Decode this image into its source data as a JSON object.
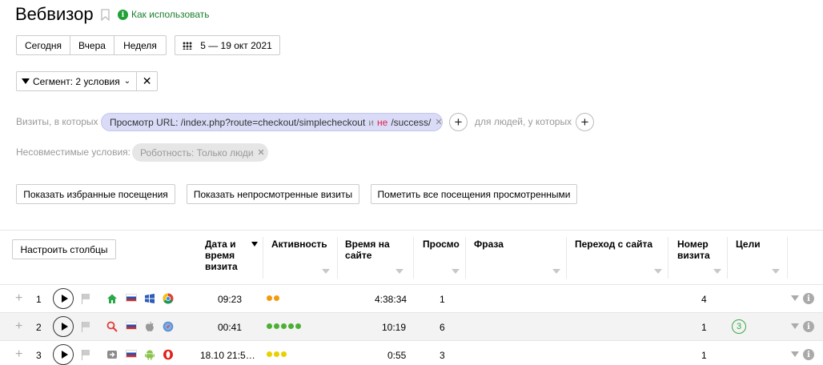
{
  "header": {
    "title": "Вебвизор",
    "how_to_use": "Как использовать"
  },
  "period": {
    "today": "Сегодня",
    "yesterday": "Вчера",
    "week": "Неделя",
    "date_range": "5 — 19 окт 2021"
  },
  "segment": {
    "label": "Сегмент: 2 условия"
  },
  "conditions": {
    "visits_label": "Визиты, в которых",
    "chip_text": "Просмотр URL: /index.php?route=checkout/simplecheckout",
    "chip_and": "и",
    "chip_not": "не",
    "chip_tail": "/success/",
    "people_label": "для людей, у которых",
    "incompatible_label": "Несовместимые условия:",
    "incompatible_chip": "Роботность: Только люди"
  },
  "actions": {
    "show_favorites": "Показать избранные посещения",
    "show_unviewed": "Показать непросмотренные визиты",
    "mark_all_viewed": "Пометить все посещения просмотренными"
  },
  "table": {
    "configure_columns": "Настроить столбцы",
    "headers": {
      "date": [
        "Дата и",
        "время",
        "визита"
      ],
      "activity": "Активность",
      "time": [
        "Время на",
        "сайте"
      ],
      "views": "Просмо",
      "phrase": "Фраза",
      "referrer": "Переход с сайта",
      "visit_number": [
        "Номер",
        "визита"
      ],
      "goals": "Цели"
    },
    "rows": [
      {
        "num": "1",
        "date": "09:23",
        "activity_color": "#f29b0d",
        "activity_count": 2,
        "time": "4:38:34",
        "views": "1",
        "visit_number": "4",
        "goals": "",
        "source_icon": "house-icon",
        "os_icon": "windows-icon",
        "browser_icon": "chrome-icon"
      },
      {
        "num": "2",
        "date": "00:41",
        "activity_color": "#4cb032",
        "activity_count": 5,
        "time": "10:19",
        "views": "6",
        "visit_number": "1",
        "goals": "3",
        "source_icon": "search-icon",
        "os_icon": "apple-icon",
        "browser_icon": "safari-icon"
      },
      {
        "num": "3",
        "date": "18.10 21:5…",
        "activity_color": "#e8d100",
        "activity_count": 3,
        "time": "0:55",
        "views": "3",
        "visit_number": "1",
        "goals": "",
        "source_icon": "direct-icon",
        "os_icon": "android-icon",
        "browser_icon": "opera-icon"
      }
    ]
  },
  "colors": {
    "accent_green": "#21a038",
    "chip_blue": "#dadbf7",
    "not_red": "#e0254a"
  }
}
